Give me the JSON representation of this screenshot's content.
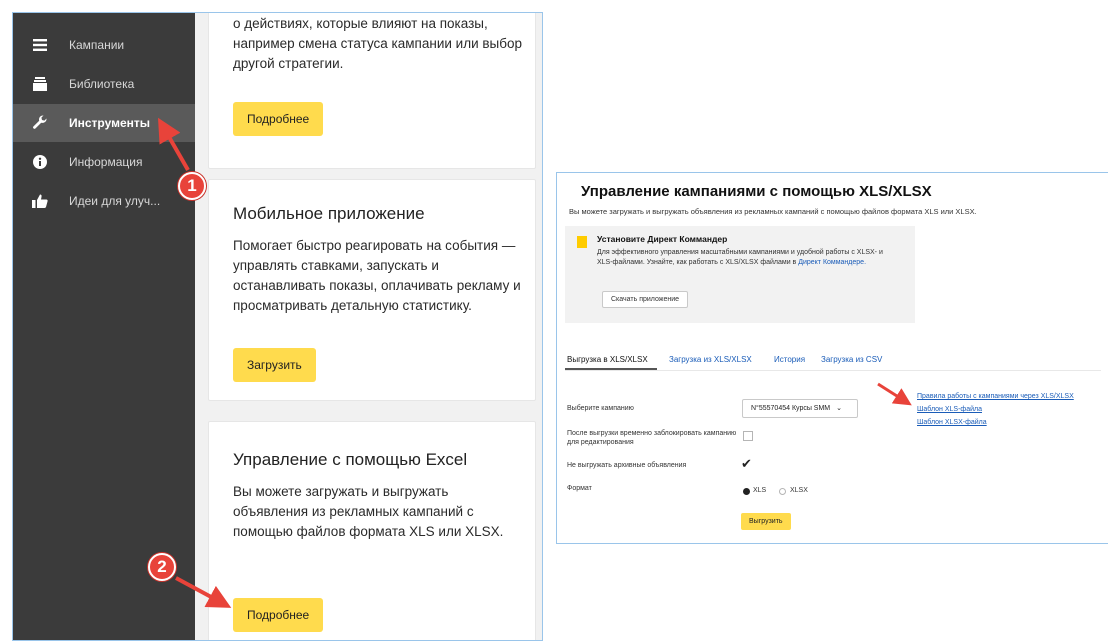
{
  "sidebar": {
    "items": [
      {
        "label": "Кампании",
        "icon": "menu-icon"
      },
      {
        "label": "Библиотека",
        "icon": "library-icon"
      },
      {
        "label": "Инструменты",
        "icon": "wrench-icon"
      },
      {
        "label": "Информация",
        "icon": "info-icon"
      },
      {
        "label": "Идеи для улуч...",
        "icon": "thumbs-up-icon"
      }
    ],
    "active_index": 2
  },
  "cards": {
    "top": {
      "text": "о действиях, которые влияют на показы, например смена статуса кампании или выбор другой стратегии.",
      "button": "Подробнее"
    },
    "mobile": {
      "title": "Мобильное приложение",
      "text": "Помогает быстро реагировать на события — управлять ставками, запускать и останавливать показы, оплачивать рекламу и просматривать детальную статистику.",
      "button": "Загрузить"
    },
    "excel": {
      "title": "Управление с помощью Excel",
      "text": "Вы можете загружать и выгружать объявления из рекламных кампаний с помощью файлов формата XLS или XLSX.",
      "button": "Подробнее"
    }
  },
  "badges": [
    "1",
    "2"
  ],
  "xls_panel": {
    "title": "Управление кампаниями с помощью XLS/XLSX",
    "description": "Вы можете загружать и выгружать объявления из рекламных кампаний с помощью файлов формата XLS или XLSX.",
    "promo": {
      "title": "Установите Директ Коммандер",
      "text": "Для эффективного управления масштабными кампаниями и удобной работы с XLSX- и XLS-файлами. Узнайте, как работать с XLS/XLSX файлами в",
      "link": "Директ Коммандере.",
      "button": "Скачать приложение"
    },
    "tabs": [
      "Выгрузка в XLS/XLSX",
      "Загрузка из XLS/XLSX",
      "История",
      "Загрузка из CSV"
    ],
    "active_tab": 0,
    "form": {
      "campaign_label": "Выберите кампанию",
      "campaign_value": "N°55570454 Курсы SMM",
      "lock_label": "После выгрузки временно заблокировать кампанию для редактирования",
      "lock_checked": false,
      "archive_label": "Не выгружать архивные объявления",
      "archive_checked": true,
      "format_label": "Формат",
      "format_options": [
        "XLS",
        "XLSX"
      ],
      "format_selected": "XLS",
      "export_button": "Выгрузить"
    },
    "links": [
      "Правила работы с кампаниями через XLS/XLSX",
      "Шаблон XLS-файла",
      "Шаблон XLSX-файла"
    ]
  },
  "colors": {
    "sidebar_bg": "#3b3b3b",
    "accent_yellow": "#ffdb4d",
    "link_blue": "#1a5cb8",
    "annotation_red": "#e8433a"
  }
}
